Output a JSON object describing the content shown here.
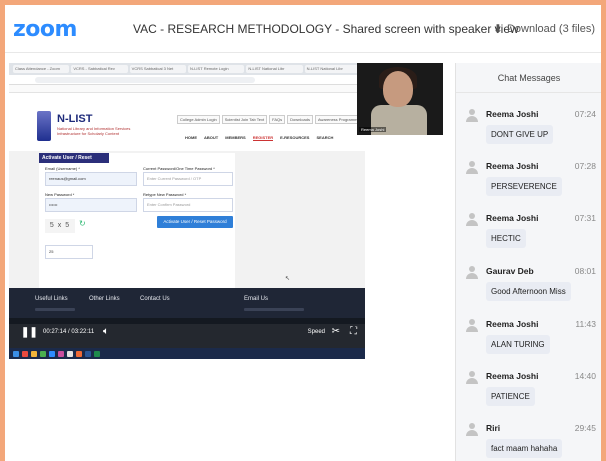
{
  "app": {
    "logo": "zoom",
    "meeting_title": "VAC - RESEARCH METHODOLOGY - Shared screen with speaker view",
    "download_label": "Download (3 files)",
    "download_icon": "download-icon"
  },
  "shared_screen": {
    "browser_tabs": [
      "Class Attendance - Zoom",
      "VCRS - Sabbatical Rev",
      "VCRS Sabbatical 3 Net",
      "N-LIST Remote Login",
      "N-LIST National Libr",
      "N-LIST National Libr"
    ],
    "site_title": "N-LIST",
    "site_subtitle": "National Library and Information Services Infrastructure for Scholarly Content",
    "top_links": [
      "College Admin Login",
      "Scientist Join Tab Text",
      "FAQs",
      "Downloads",
      "Awareness Programmes"
    ],
    "nav": [
      "HOME",
      "ABOUT",
      "MEMBERS",
      "REGISTER",
      "E-RESOURCES",
      "SEARCH"
    ],
    "nav_active": "REGISTER",
    "form": {
      "heading": "Activate User / Reset Password",
      "email_label": "Email (Username) *",
      "email_value": "reenaus@gmail.com",
      "otp_label": "Current Password/One Time Password *",
      "otp_placeholder": "Enter Current Password / OTP",
      "newpass_label": "New Password *",
      "newpass_value": "••••••",
      "retype_label": "Retype New Password *",
      "retype_placeholder": "Enter Confirm Password",
      "captcha": "5 x 5",
      "captcha_answer": "25",
      "button": "Activate User / Reset Password"
    },
    "footer_links": [
      "Useful Links",
      "Other Links",
      "Contact Us",
      "Email Us"
    ]
  },
  "player": {
    "current_time": "00:27:14",
    "total_time": "03:22:11",
    "time_display": "00:27:14 / 03:22:11",
    "speed_label": "Speed",
    "pause_icon": "pause-icon",
    "volume_icon": "volume-icon",
    "scissors_icon": "scissors-icon",
    "fullscreen_icon": "fullscreen-icon"
  },
  "speaker": {
    "name": "Reema Joshi"
  },
  "chat": {
    "title": "Chat Messages",
    "messages": [
      {
        "sender": "Reema Joshi",
        "time": "07:24",
        "text": "DONT GIVE UP"
      },
      {
        "sender": "Reema Joshi",
        "time": "07:28",
        "text": "PERSEVERENCE"
      },
      {
        "sender": "Reema Joshi",
        "time": "07:31",
        "text": "HECTIC"
      },
      {
        "sender": "Gaurav Deb",
        "time": "08:01",
        "text": "Good Afternoon Miss"
      },
      {
        "sender": "Reema Joshi",
        "time": "11:43",
        "text": "ALAN TURING"
      },
      {
        "sender": "Reema Joshi",
        "time": "14:40",
        "text": "PATIENCE"
      },
      {
        "sender": "Riri",
        "time": "29:45",
        "text": "fact maam hahaha"
      }
    ]
  }
}
